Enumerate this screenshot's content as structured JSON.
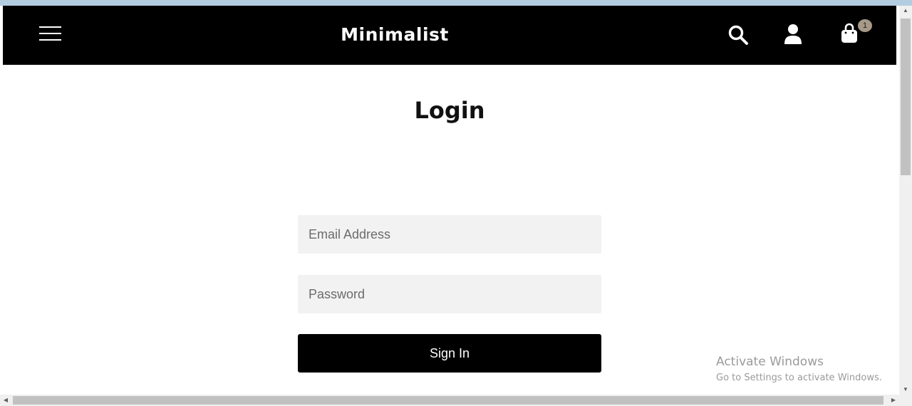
{
  "header": {
    "brand": "Minimalist",
    "cart_count": "1",
    "menu_icon": "hamburger-icon",
    "search_icon": "search-icon",
    "account_icon": "user-icon",
    "cart_icon": "shopping-bag-icon"
  },
  "login": {
    "title": "Login",
    "email_placeholder": "Email Address",
    "password_placeholder": "Password",
    "submit_label": "Sign In"
  },
  "watermark": {
    "line1": "Activate Windows",
    "line2": "Go to Settings to activate Windows."
  },
  "colors": {
    "header_bg": "#000000",
    "badge": "#a69987",
    "input_bg": "#f2f2f2",
    "button_bg": "#000000"
  }
}
